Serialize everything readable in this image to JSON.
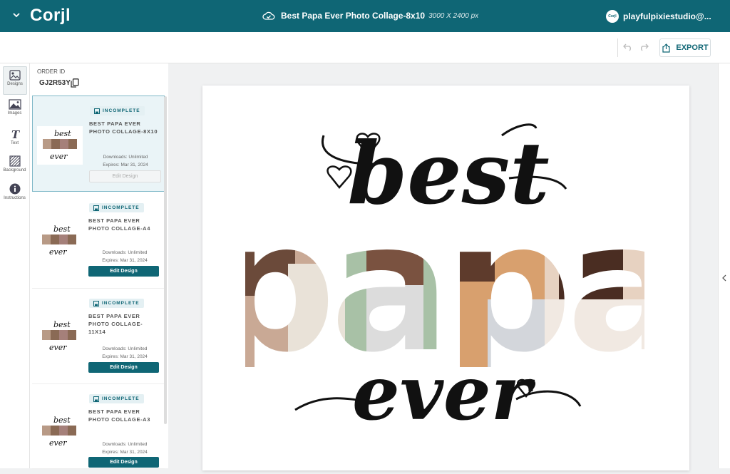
{
  "app": {
    "name": "Corjl"
  },
  "header": {
    "title": "Best Papa Ever Photo Collage-8x10",
    "size": "3000 X 2400 px",
    "user": "playfulpixiestudio@...",
    "avatar_text": "Corjl"
  },
  "toolbar": {
    "export_label": "EXPORT"
  },
  "rail": [
    {
      "label": "Designs",
      "icon": "designs-icon"
    },
    {
      "label": "Images",
      "icon": "image-icon"
    },
    {
      "label": "Text",
      "icon": "text-icon"
    },
    {
      "label": "Background",
      "icon": "background-icon"
    },
    {
      "label": "Instructions",
      "icon": "info-icon"
    }
  ],
  "order": {
    "label": "ORDER ID",
    "id": "GJ2R53Y"
  },
  "designs": [
    {
      "status": "INCOMPLETE",
      "title": "BEST PAPA EVER PHOTO COLLAGE-8X10",
      "downloads": "Downloads: Unlimited",
      "expires": "Expires: Mar 31, 2024",
      "button": "Edit Design"
    },
    {
      "status": "INCOMPLETE",
      "title": "BEST PAPA EVER PHOTO COLLAGE-A4",
      "downloads": "Downloads: Unlimited",
      "expires": "Expires: Mar 31, 2024",
      "button": "Edit Design"
    },
    {
      "status": "INCOMPLETE",
      "title": "BEST PAPA EVER PHOTO COLLAGE-11X14",
      "downloads": "Downloads: Unlimited",
      "expires": "Expires: Mar 31, 2024",
      "button": "Edit Design"
    },
    {
      "status": "INCOMPLETE",
      "title": "BEST PAPA EVER PHOTO COLLAGE-A3",
      "downloads": "Downloads: Unlimited",
      "expires": "Expires: Mar 31, 2024",
      "button": "Edit Design"
    }
  ],
  "artwork": {
    "word1": "best",
    "word2": "papa",
    "word3": "ever"
  },
  "colors": {
    "brand": "#0f6675",
    "ink": "#111111"
  }
}
